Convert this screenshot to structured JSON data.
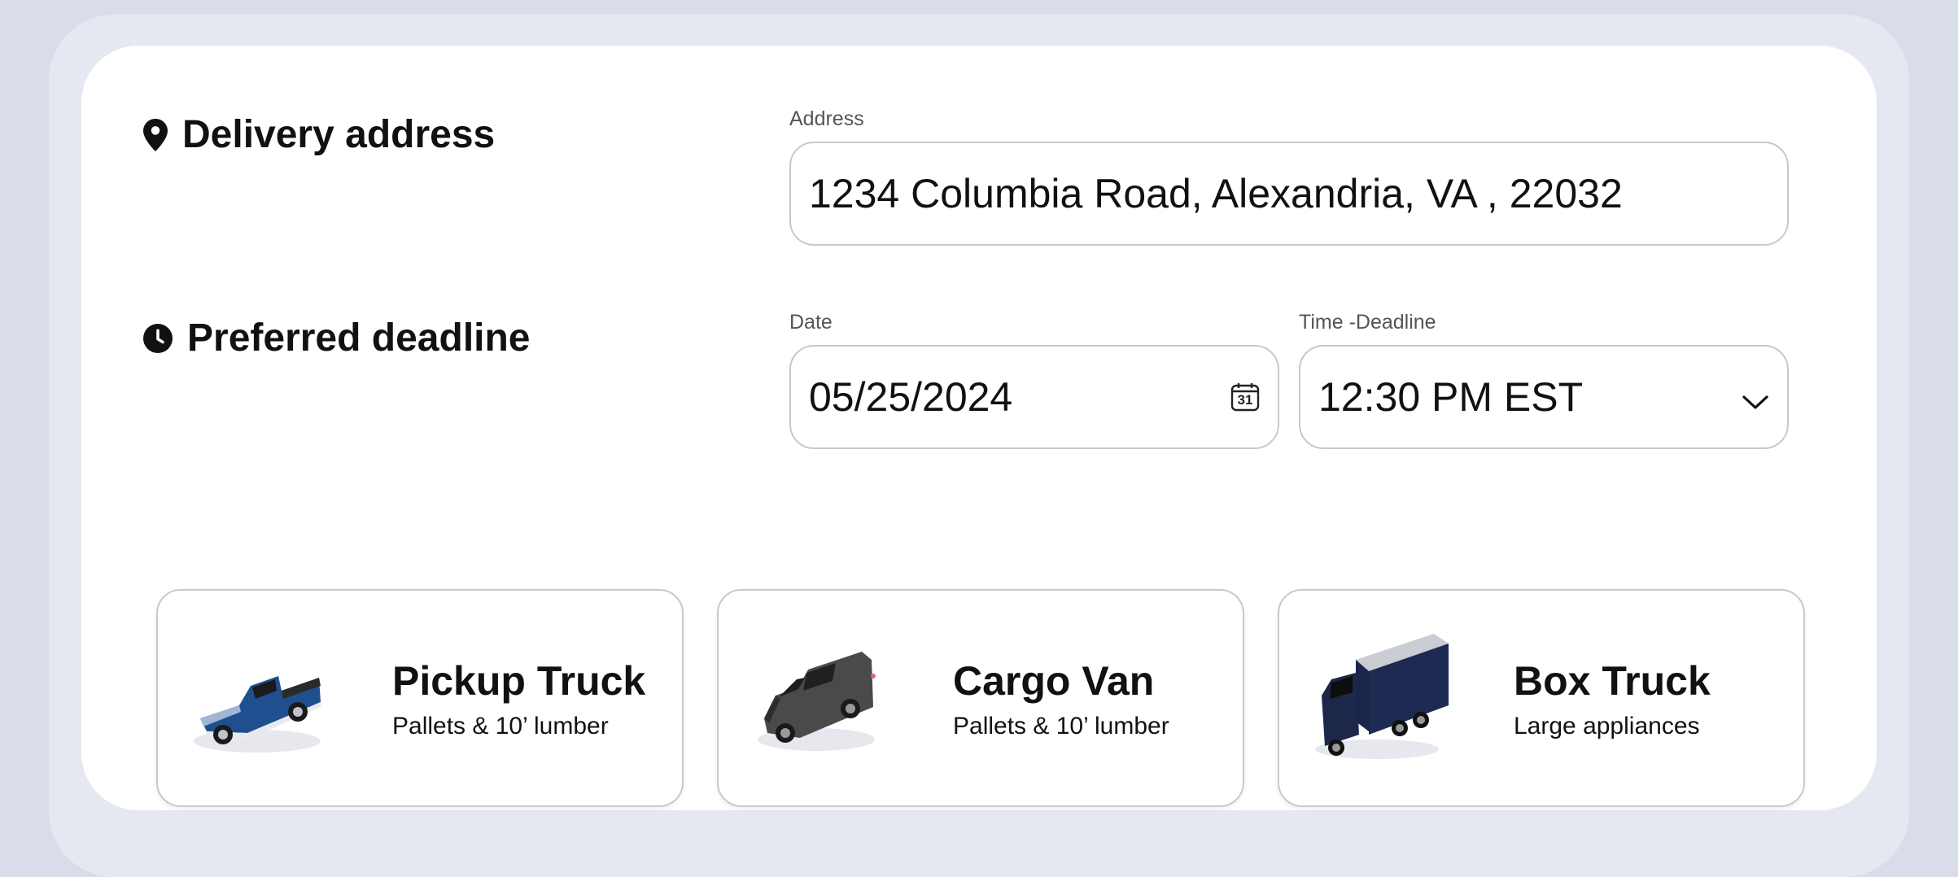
{
  "delivery": {
    "title": "Delivery address",
    "address_label": "Address",
    "address_value": "1234 Columbia Road, Alexandria, VA , 22032"
  },
  "deadline": {
    "title": "Preferred deadline",
    "date_label": "Date",
    "date_value": "05/25/2024",
    "calendar_day": "31",
    "time_label": "Time -Deadline",
    "time_value": "12:30 PM EST"
  },
  "vehicles": [
    {
      "name": "Pickup Truck",
      "description": "Pallets & 10’ lumber",
      "icon": "pickup-truck-icon",
      "color": "#1f4f8f"
    },
    {
      "name": "Cargo Van",
      "description": "Pallets & 10’ lumber",
      "icon": "cargo-van-icon",
      "color": "#4a4a4a"
    },
    {
      "name": "Box Truck",
      "description": "Large appliances",
      "icon": "box-truck-icon",
      "color": "#1d2b52"
    }
  ]
}
